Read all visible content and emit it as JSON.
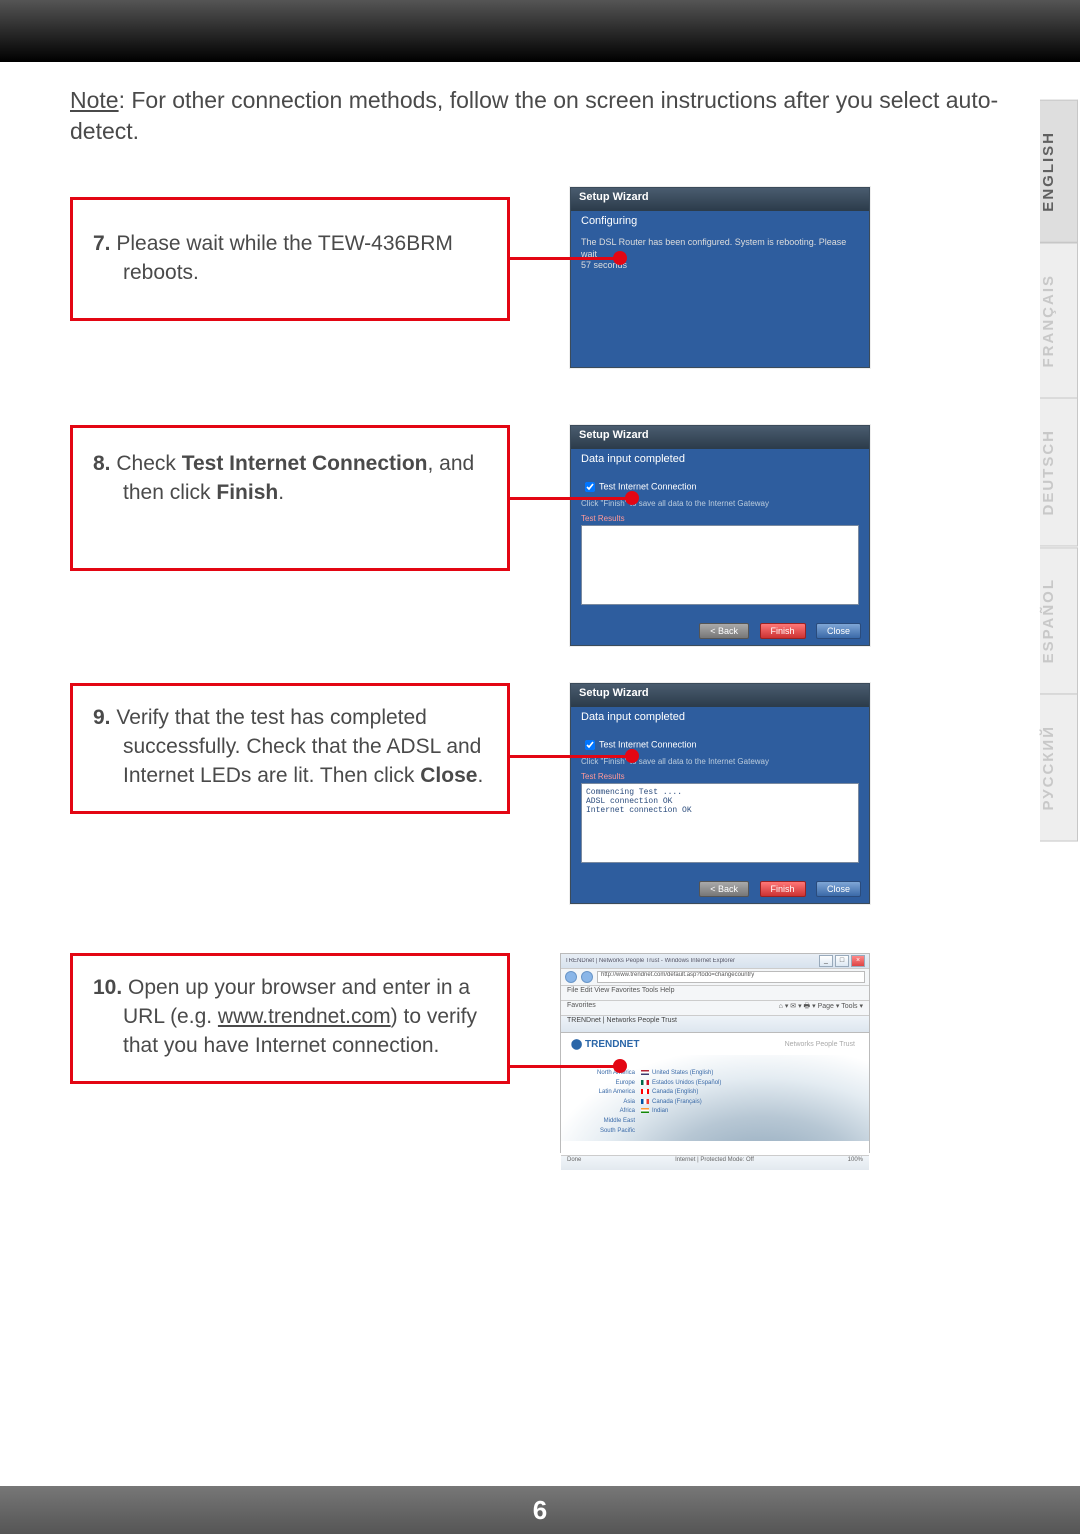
{
  "note_prefix": "Note",
  "note_text": ": For other connection methods, follow the on screen instructions after you select auto-detect.",
  "steps": {
    "s7": {
      "num": "7.",
      "text": " Please wait while the TEW-436BRM reboots."
    },
    "s8": {
      "num": "8.",
      "pre": " Check ",
      "b1": "Test Internet Connection",
      "mid": ", and then click ",
      "b2": "Finish",
      "post": "."
    },
    "s9": {
      "num": "9.",
      "pre": " Verify that the test has completed successfully. Check that the ADSL and Internet LEDs are lit. Then click ",
      "b1": "Close",
      "post": "."
    },
    "s10": {
      "num": "10.",
      "pre": " Open up your browser and enter in a URL (e.g. ",
      "link": "www.trendnet.com",
      "post": ") to verify that you have Internet connection."
    }
  },
  "wizard_title": "Setup Wizard",
  "w1": {
    "sub": "Configuring",
    "msg": "The DSL Router has been configured. System is rebooting. Please wait\n57 seconds"
  },
  "w2": {
    "sub": "Data input completed",
    "check": "Test Internet Connection",
    "hint": "Click \"Finish\" to save all data to the Internet Gateway",
    "results_label": "Test Results",
    "results": "",
    "btn_back": "< Back",
    "btn_finish": "Finish",
    "btn_close": "Close"
  },
  "w3": {
    "sub": "Data input completed",
    "check": "Test Internet Connection",
    "hint": "Click \"Finish\" to save all data to the Internet Gateway",
    "results_label": "Test Results",
    "results": "Commencing Test ....\nADSL connection OK\nInternet connection OK",
    "btn_back": "< Back",
    "btn_finish": "Finish",
    "btn_close": "Close"
  },
  "browser": {
    "title": "TRENDnet | Networks People Trust - Windows Internet Explorer",
    "url": "http://www.trendnet.com/default.asp?todo=changecountry",
    "menu": "File  Edit  View  Favorites  Tools  Help",
    "fav_label": "Favorites",
    "tab": "TRENDnet | Networks People Trust",
    "logo": "TRENDNET",
    "slogan": "Networks People Trust",
    "regions": {
      "North America": "United States (English)",
      "Europe": "Estados Unidos (Español)",
      "Latin America": "Canada (English)",
      "Asia": "Canada (Français)",
      "Africa": "Indian",
      "Middle East": "",
      "South Pacific": ""
    },
    "status_left": "Done",
    "status_mid": "Internet | Protected Mode: Off",
    "status_right": "100%"
  },
  "languages": [
    "ENGLISH",
    "FRANÇAIS",
    "DEUTSCH",
    "ESPAÑOL",
    "РУССКИЙ"
  ],
  "page_number": "6"
}
